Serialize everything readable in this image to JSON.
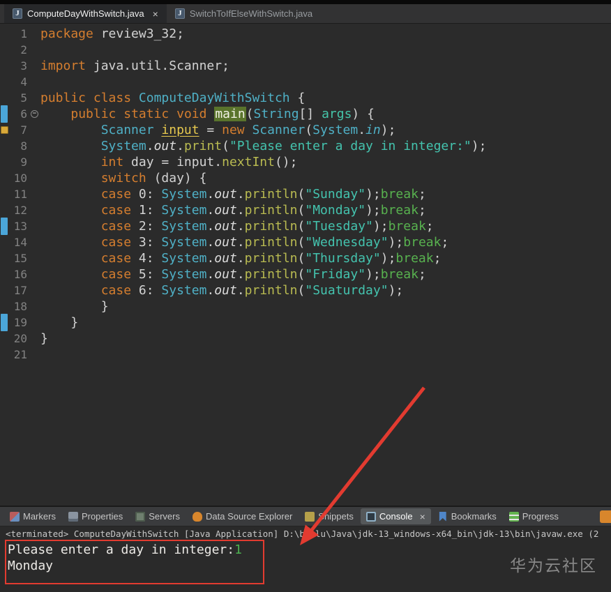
{
  "ui": {
    "close_glyph": "×",
    "fold_glyph": "−",
    "java_icon_glyph": "J"
  },
  "colors": {
    "annotation_red": "#e23b30",
    "keyword_orange": "#d57e2f",
    "type_cyan": "#4fb0c6",
    "string_teal": "#44c3ae",
    "occurrence_green": "#5a742c",
    "marker_blue": "#4ba6d9",
    "bookmark_yellow": "#d9a93a"
  },
  "editor_tabs": [
    {
      "label": "ComputeDayWithSwitch.java",
      "active": true,
      "closable": true
    },
    {
      "label": "SwitchToIfElseWithSwitch.java",
      "active": false,
      "closable": false
    }
  ],
  "code": {
    "lines": [
      {
        "n": "1",
        "segs": [
          {
            "t": "package",
            "c": "kw"
          },
          {
            "t": " review3_32;",
            "c": "pl"
          }
        ]
      },
      {
        "n": "2",
        "segs": []
      },
      {
        "n": "3",
        "segs": [
          {
            "t": "import",
            "c": "kw"
          },
          {
            "t": " java.util.Scanner;",
            "c": "pl"
          }
        ]
      },
      {
        "n": "4",
        "segs": []
      },
      {
        "n": "5",
        "segs": [
          {
            "t": "public",
            "c": "kw"
          },
          {
            "t": " ",
            "c": "pl"
          },
          {
            "t": "class",
            "c": "kw"
          },
          {
            "t": " ",
            "c": "pl"
          },
          {
            "t": "ComputeDayWithSwitch",
            "c": "cls"
          },
          {
            "t": " {",
            "c": "pl"
          }
        ]
      },
      {
        "n": "6",
        "fold": true,
        "marker": "range",
        "segs": [
          {
            "t": "    ",
            "c": "pl"
          },
          {
            "t": "public",
            "c": "kw"
          },
          {
            "t": " ",
            "c": "pl"
          },
          {
            "t": "static",
            "c": "kw"
          },
          {
            "t": " ",
            "c": "pl"
          },
          {
            "t": "void",
            "c": "kw"
          },
          {
            "t": " ",
            "c": "pl"
          },
          {
            "t": "main",
            "c": "main"
          },
          {
            "t": "(",
            "c": "pl"
          },
          {
            "t": "String",
            "c": "cls"
          },
          {
            "t": "[] ",
            "c": "pl"
          },
          {
            "t": "args",
            "c": "par"
          },
          {
            "t": ") {",
            "c": "pl"
          }
        ]
      },
      {
        "n": "7",
        "marker": "bookmark",
        "segs": [
          {
            "t": "        ",
            "c": "pl"
          },
          {
            "t": "Scanner",
            "c": "cls"
          },
          {
            "t": " ",
            "c": "pl"
          },
          {
            "t": "input",
            "c": "inp"
          },
          {
            "t": " = ",
            "c": "pl"
          },
          {
            "t": "new",
            "c": "kw"
          },
          {
            "t": " ",
            "c": "pl"
          },
          {
            "t": "Scanner",
            "c": "cls"
          },
          {
            "t": "(",
            "c": "pl"
          },
          {
            "t": "System",
            "c": "cls"
          },
          {
            "t": ".",
            "c": "pl"
          },
          {
            "t": "in",
            "c": "fin"
          },
          {
            "t": ");",
            "c": "pl"
          }
        ]
      },
      {
        "n": "8",
        "segs": [
          {
            "t": "        ",
            "c": "pl"
          },
          {
            "t": "System",
            "c": "cls"
          },
          {
            "t": ".",
            "c": "pl"
          },
          {
            "t": "out",
            "c": "fld"
          },
          {
            "t": ".",
            "c": "pl"
          },
          {
            "t": "print",
            "c": "mth"
          },
          {
            "t": "(",
            "c": "pl"
          },
          {
            "t": "\"Please enter a day in integer:\"",
            "c": "str"
          },
          {
            "t": ");",
            "c": "pl"
          }
        ]
      },
      {
        "n": "9",
        "segs": [
          {
            "t": "        ",
            "c": "pl"
          },
          {
            "t": "int",
            "c": "kw"
          },
          {
            "t": " day = input.",
            "c": "pl"
          },
          {
            "t": "nextInt",
            "c": "mth"
          },
          {
            "t": "();",
            "c": "pl"
          }
        ]
      },
      {
        "n": "10",
        "segs": [
          {
            "t": "        ",
            "c": "pl"
          },
          {
            "t": "switch",
            "c": "kw"
          },
          {
            "t": " (day) {",
            "c": "pl"
          }
        ]
      },
      {
        "n": "11",
        "segs": [
          {
            "t": "        ",
            "c": "pl"
          },
          {
            "t": "case",
            "c": "kw"
          },
          {
            "t": " 0: ",
            "c": "pl"
          },
          {
            "t": "System",
            "c": "cls"
          },
          {
            "t": ".",
            "c": "pl"
          },
          {
            "t": "out",
            "c": "fld"
          },
          {
            "t": ".",
            "c": "pl"
          },
          {
            "t": "println",
            "c": "mth"
          },
          {
            "t": "(",
            "c": "pl"
          },
          {
            "t": "\"Sunday\"",
            "c": "str"
          },
          {
            "t": ");",
            "c": "pl"
          },
          {
            "t": "break",
            "c": "brk"
          },
          {
            "t": ";",
            "c": "pl"
          }
        ]
      },
      {
        "n": "12",
        "segs": [
          {
            "t": "        ",
            "c": "pl"
          },
          {
            "t": "case",
            "c": "kw"
          },
          {
            "t": " 1: ",
            "c": "pl"
          },
          {
            "t": "System",
            "c": "cls"
          },
          {
            "t": ".",
            "c": "pl"
          },
          {
            "t": "out",
            "c": "fld"
          },
          {
            "t": ".",
            "c": "pl"
          },
          {
            "t": "println",
            "c": "mth"
          },
          {
            "t": "(",
            "c": "pl"
          },
          {
            "t": "\"Monday\"",
            "c": "str"
          },
          {
            "t": ");",
            "c": "pl"
          },
          {
            "t": "break",
            "c": "brk"
          },
          {
            "t": ";",
            "c": "pl"
          }
        ]
      },
      {
        "n": "13",
        "marker": "range",
        "segs": [
          {
            "t": "        ",
            "c": "pl"
          },
          {
            "t": "case",
            "c": "kw"
          },
          {
            "t": " 2: ",
            "c": "pl"
          },
          {
            "t": "System",
            "c": "cls"
          },
          {
            "t": ".",
            "c": "pl"
          },
          {
            "t": "out",
            "c": "fld"
          },
          {
            "t": ".",
            "c": "pl"
          },
          {
            "t": "println",
            "c": "mth"
          },
          {
            "t": "(",
            "c": "pl"
          },
          {
            "t": "\"Tuesday\"",
            "c": "str"
          },
          {
            "t": ");",
            "c": "pl"
          },
          {
            "t": "break",
            "c": "brk"
          },
          {
            "t": ";",
            "c": "pl"
          }
        ]
      },
      {
        "n": "14",
        "segs": [
          {
            "t": "        ",
            "c": "pl"
          },
          {
            "t": "case",
            "c": "kw"
          },
          {
            "t": " 3: ",
            "c": "pl"
          },
          {
            "t": "System",
            "c": "cls"
          },
          {
            "t": ".",
            "c": "pl"
          },
          {
            "t": "out",
            "c": "fld"
          },
          {
            "t": ".",
            "c": "pl"
          },
          {
            "t": "println",
            "c": "mth"
          },
          {
            "t": "(",
            "c": "pl"
          },
          {
            "t": "\"Wednesday\"",
            "c": "str"
          },
          {
            "t": ");",
            "c": "pl"
          },
          {
            "t": "break",
            "c": "brk"
          },
          {
            "t": ";",
            "c": "pl"
          }
        ]
      },
      {
        "n": "15",
        "segs": [
          {
            "t": "        ",
            "c": "pl"
          },
          {
            "t": "case",
            "c": "kw"
          },
          {
            "t": " 4: ",
            "c": "pl"
          },
          {
            "t": "System",
            "c": "cls"
          },
          {
            "t": ".",
            "c": "pl"
          },
          {
            "t": "out",
            "c": "fld"
          },
          {
            "t": ".",
            "c": "pl"
          },
          {
            "t": "println",
            "c": "mth"
          },
          {
            "t": "(",
            "c": "pl"
          },
          {
            "t": "\"Thursday\"",
            "c": "str"
          },
          {
            "t": ");",
            "c": "pl"
          },
          {
            "t": "break",
            "c": "brk"
          },
          {
            "t": ";",
            "c": "pl"
          }
        ]
      },
      {
        "n": "16",
        "segs": [
          {
            "t": "        ",
            "c": "pl"
          },
          {
            "t": "case",
            "c": "kw"
          },
          {
            "t": " 5: ",
            "c": "pl"
          },
          {
            "t": "System",
            "c": "cls"
          },
          {
            "t": ".",
            "c": "pl"
          },
          {
            "t": "out",
            "c": "fld"
          },
          {
            "t": ".",
            "c": "pl"
          },
          {
            "t": "println",
            "c": "mth"
          },
          {
            "t": "(",
            "c": "pl"
          },
          {
            "t": "\"Friday\"",
            "c": "str"
          },
          {
            "t": ");",
            "c": "pl"
          },
          {
            "t": "break",
            "c": "brk"
          },
          {
            "t": ";",
            "c": "pl"
          }
        ]
      },
      {
        "n": "17",
        "segs": [
          {
            "t": "        ",
            "c": "pl"
          },
          {
            "t": "case",
            "c": "kw"
          },
          {
            "t": " 6: ",
            "c": "pl"
          },
          {
            "t": "System",
            "c": "cls"
          },
          {
            "t": ".",
            "c": "pl"
          },
          {
            "t": "out",
            "c": "fld"
          },
          {
            "t": ".",
            "c": "pl"
          },
          {
            "t": "println",
            "c": "mth"
          },
          {
            "t": "(",
            "c": "pl"
          },
          {
            "t": "\"Suaturday\"",
            "c": "str"
          },
          {
            "t": ");",
            "c": "pl"
          }
        ]
      },
      {
        "n": "18",
        "segs": [
          {
            "t": "        }",
            "c": "pl"
          }
        ]
      },
      {
        "n": "19",
        "marker": "range",
        "segs": [
          {
            "t": "    }",
            "c": "pl"
          }
        ]
      },
      {
        "n": "20",
        "segs": [
          {
            "t": "}",
            "c": "pl"
          }
        ]
      },
      {
        "n": "21",
        "segs": []
      }
    ]
  },
  "bottom_tabs": [
    {
      "label": "Markers",
      "icon": "markers-icon"
    },
    {
      "label": "Properties",
      "icon": "properties-icon"
    },
    {
      "label": "Servers",
      "icon": "servers-icon"
    },
    {
      "label": "Data Source Explorer",
      "icon": "datasource-icon"
    },
    {
      "label": "Snippets",
      "icon": "snippets-icon"
    },
    {
      "label": "Console",
      "icon": "console-icon",
      "active": true,
      "closable": true
    },
    {
      "label": "Bookmarks",
      "icon": "bookmarks-icon"
    },
    {
      "label": "Progress",
      "icon": "progress-icon"
    }
  ],
  "console": {
    "header": "<terminated> ComputeDayWithSwitch [Java Application] D:\\bailu\\Java\\jdk-13_windows-x64_bin\\jdk-13\\bin\\javaw.exe (2",
    "lines": [
      {
        "segs": [
          {
            "t": "Please enter a day in integer:",
            "c": "out"
          },
          {
            "t": "1",
            "c": "in"
          }
        ]
      },
      {
        "segs": [
          {
            "t": "Monday",
            "c": "out"
          }
        ]
      }
    ]
  },
  "watermark": "华为云社区"
}
